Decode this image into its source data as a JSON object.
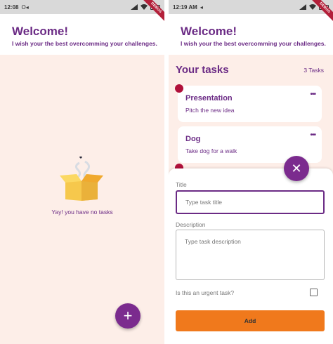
{
  "left": {
    "statusbar": {
      "time": "12:08",
      "icons": [
        "O",
        "◂"
      ],
      "debug": "DEBUG"
    },
    "header": {
      "title": "Welcome!",
      "subtitle": "I wish your the best overcomming your challenges."
    },
    "empty_state": {
      "text": "Yay! you have no tasks",
      "illustration": "empty-box-icon"
    },
    "fab": {
      "glyph": "+",
      "icon": "plus-icon",
      "color": "#7b2b8e"
    }
  },
  "right": {
    "statusbar": {
      "time": "12:19 AM",
      "icons": [
        "◂"
      ],
      "debug": "DEBUG"
    },
    "header": {
      "title": "Welcome!",
      "subtitle": "I wish your the best overcomming your challenges."
    },
    "tasks": {
      "title": "Your tasks",
      "count": "3 Tasks",
      "items": [
        {
          "title": "Presentation",
          "description": "Pitch the new idea",
          "menu": "•••",
          "urgent": true
        },
        {
          "title": "Dog",
          "description": "Take dog for a walk",
          "menu": "•••",
          "urgent": false
        }
      ]
    },
    "fab": {
      "glyph": "✕",
      "icon": "close-icon",
      "color": "#7b2b8e"
    },
    "form": {
      "title_label": "Title",
      "title_placeholder": "Type task title",
      "description_label": "Description",
      "description_placeholder": "Type task description",
      "urgent_label": "Is this an urgent task?",
      "urgent_checked": false,
      "add_label": "Add",
      "add_color": "#f0791c"
    }
  },
  "colors": {
    "primary": "#6b2b85",
    "background": "#fdeee8",
    "urgent": "#b0103a"
  }
}
